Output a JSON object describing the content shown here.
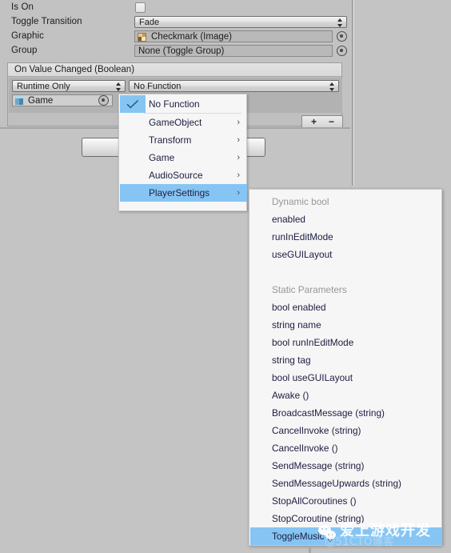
{
  "colors": {
    "panel_bg": "#c2c2c2",
    "window_bg": "#c4c4c4",
    "menu_bg": "#f6f6f6",
    "highlight": "#86c5f3",
    "menu_text": "#1d1d40",
    "menu_header_text": "#979797"
  },
  "inspector": {
    "properties": [
      {
        "label": "Is On",
        "type": "checkbox",
        "value": "",
        "checked": false
      },
      {
        "label": "Toggle Transition",
        "type": "enum",
        "value": "Fade"
      },
      {
        "label": "Graphic",
        "type": "object",
        "value": "Checkmark (Image)",
        "icon": "image-asset-icon"
      },
      {
        "label": "Group",
        "type": "object",
        "value": "None (Toggle Group)",
        "icon": "none"
      }
    ],
    "event": {
      "header": "On Value Changed (Boolean)",
      "call_mode": "Runtime Only",
      "function": "No Function",
      "target_object": "Game",
      "target_icon": "game-object-cube-icon",
      "add_label": "+",
      "remove_label": "−"
    }
  },
  "menu": {
    "items": [
      {
        "label": "No Function",
        "checked": true,
        "submenu": false,
        "selected": false
      },
      {
        "label": "GameObject",
        "checked": false,
        "submenu": true,
        "selected": false
      },
      {
        "label": "Transform",
        "checked": false,
        "submenu": true,
        "selected": false
      },
      {
        "label": "Game",
        "checked": false,
        "submenu": true,
        "selected": false
      },
      {
        "label": "AudioSource",
        "checked": false,
        "submenu": true,
        "selected": false
      },
      {
        "label": "PlayerSettings",
        "checked": false,
        "submenu": true,
        "selected": true
      }
    ],
    "chevron": "›",
    "check_icon": "checkmark-icon"
  },
  "submenu": {
    "items": [
      {
        "label": "Dynamic bool",
        "kind": "header",
        "selected": false
      },
      {
        "label": "enabled",
        "kind": "item",
        "selected": false
      },
      {
        "label": "runInEditMode",
        "kind": "item",
        "selected": false
      },
      {
        "label": "useGUILayout",
        "kind": "item",
        "selected": false
      },
      {
        "label": "",
        "kind": "spacer",
        "selected": false
      },
      {
        "label": "Static Parameters",
        "kind": "header",
        "selected": false
      },
      {
        "label": "bool enabled",
        "kind": "item",
        "selected": false
      },
      {
        "label": "string name",
        "kind": "item",
        "selected": false
      },
      {
        "label": "bool runInEditMode",
        "kind": "item",
        "selected": false
      },
      {
        "label": "string tag",
        "kind": "item",
        "selected": false
      },
      {
        "label": "bool useGUILayout",
        "kind": "item",
        "selected": false
      },
      {
        "label": "Awake ()",
        "kind": "item",
        "selected": false
      },
      {
        "label": "BroadcastMessage (string)",
        "kind": "item",
        "selected": false
      },
      {
        "label": "CancelInvoke (string)",
        "kind": "item",
        "selected": false
      },
      {
        "label": "CancelInvoke ()",
        "kind": "item",
        "selected": false
      },
      {
        "label": "SendMessage (string)",
        "kind": "item",
        "selected": false
      },
      {
        "label": "SendMessageUpwards (string)",
        "kind": "item",
        "selected": false
      },
      {
        "label": "StopAllCoroutines ()",
        "kind": "item",
        "selected": false
      },
      {
        "label": "StopCoroutine (string)",
        "kind": "item",
        "selected": false
      },
      {
        "label": "ToggleMusic ()",
        "kind": "item",
        "selected": true
      }
    ]
  },
  "watermark": {
    "brand": "爱上游戏开发",
    "sub": "@51CTO博客",
    "logo": "wechat-icon"
  }
}
